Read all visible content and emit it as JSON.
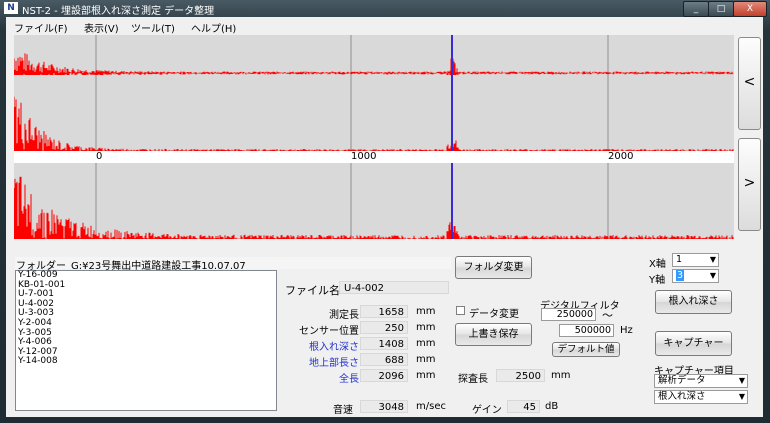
{
  "window": {
    "title": "NST-2 - 埋設部根入れ深さ測定 データ整理",
    "app_icon": "N",
    "controls": [
      "_",
      "□",
      "X"
    ]
  },
  "menu": [
    "ファイル(F)",
    "表示(V)",
    "ツール(T)",
    "ヘルプ(H)"
  ],
  "plots": {
    "axis_ticks": [
      "0",
      "1000",
      "2000"
    ],
    "signal_color": "#ff0000",
    "marker_color": "#3a2bd6",
    "background": "#d9d9d9"
  },
  "nav": {
    "up": "<",
    "down": ">"
  },
  "folder": {
    "label": "フォルダー",
    "path": "G:¥23号舞出中道路建設工事10.07.07",
    "change_button": "フォルダ変更"
  },
  "files": [
    "Y-16-009",
    "KB-01-001",
    "U-7-001",
    "U-4-002",
    "U-3-003",
    "Y-2-004",
    "Y-3-005",
    "Y-4-006",
    "Y-12-007",
    "Y-14-008"
  ],
  "file": {
    "label": "ファイル名",
    "value": "U-4-002"
  },
  "measures": [
    {
      "label": "測定長",
      "value": "1658",
      "unit": "mm",
      "blue": false
    },
    {
      "label": "センサー位置",
      "value": "250",
      "unit": "mm",
      "blue": false
    },
    {
      "label": "根入れ深さ",
      "value": "1408",
      "unit": "mm",
      "blue": true
    },
    {
      "label": "地上部長さ",
      "value": "688",
      "unit": "mm",
      "blue": true
    },
    {
      "label": "全長",
      "value": "2096",
      "unit": "mm",
      "blue": true
    }
  ],
  "data_change": {
    "label": "データ変更",
    "checked": false
  },
  "save_button": "上書き保存",
  "filter": {
    "label": "デジタルフィルタ",
    "low": "250000",
    "tilde": "〜",
    "high": "500000",
    "unit": "Hz",
    "default_button": "デフォルト値"
  },
  "probe": {
    "label": "探査長",
    "value": "2500",
    "unit": "mm"
  },
  "speed": {
    "label": "音速",
    "value": "3048",
    "unit": "m/sec"
  },
  "gain": {
    "label": "ゲイン",
    "value": "45",
    "unit": "dB"
  },
  "axes": {
    "x_label": "X軸",
    "x_value": "1",
    "y_label": "Y軸",
    "y_value": "3"
  },
  "depth_button": "根入れ深さ",
  "capture_button": "キャプチャー",
  "capture_items": {
    "label": "キャプチャー項目",
    "first": "解析データ",
    "second": "根入れ深さ"
  }
}
